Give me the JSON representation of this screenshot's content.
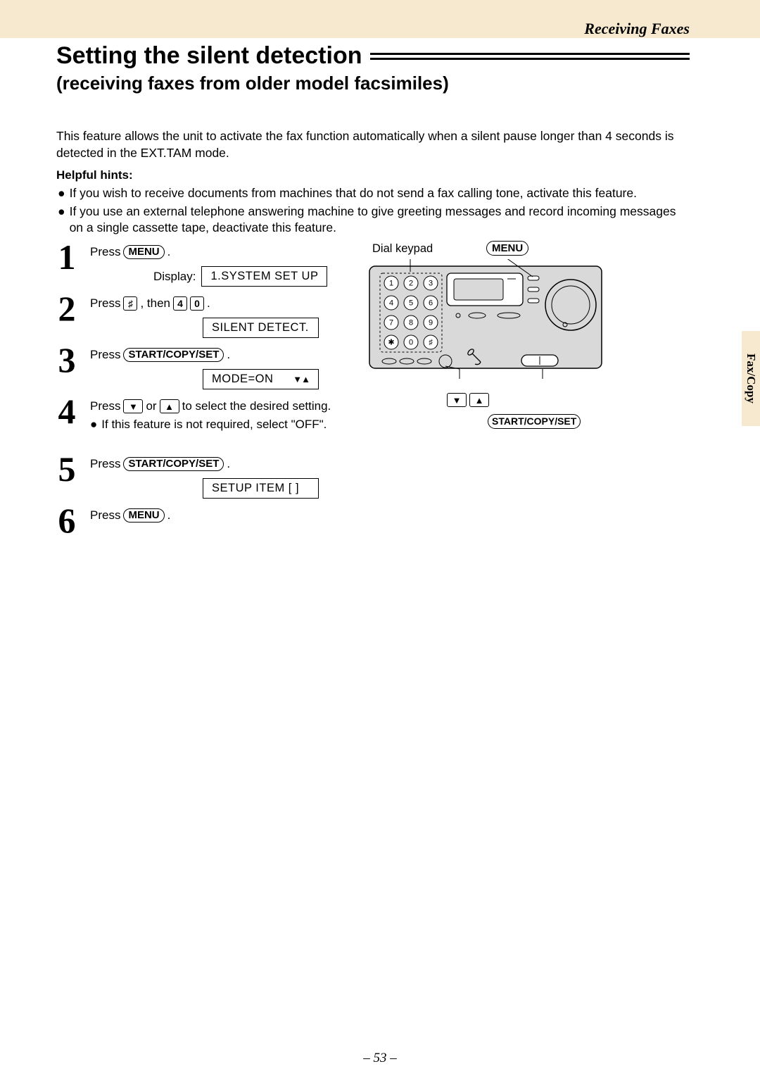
{
  "header": {
    "section": "Receiving Faxes",
    "title": "Setting the silent detection",
    "subtitle": "(receiving faxes from older model facsimiles)"
  },
  "intro": "This feature allows the unit to activate the fax function automatically when a silent pause longer than 4 seconds is detected in the EXT.TAM mode.",
  "hints": {
    "heading": "Helpful hints:",
    "items": [
      "If you wish to receive documents from machines that do not send a fax calling tone, activate this feature.",
      "If you use an external telephone answering machine to give greeting messages and record incoming messages on a single cassette tape, deactivate this feature."
    ]
  },
  "buttons": {
    "menu": "MENU",
    "start_copy_set": "START/COPY/SET"
  },
  "keys": {
    "hash": "♯",
    "four": "4",
    "zero": "0",
    "down": "▼",
    "up": "▲"
  },
  "diagram": {
    "dial_keypad_label": "Dial keypad",
    "menu_label": "MENU",
    "start_label": "START/COPY/SET",
    "arrows_down": "▼",
    "arrows_up": "▲",
    "keypad": [
      "1",
      "2",
      "3",
      "4",
      "5",
      "6",
      "7",
      "8",
      "9",
      "✱",
      "0",
      "♯"
    ]
  },
  "steps": [
    {
      "num": "1",
      "pre": "Press ",
      "btn": "MENU",
      "post": " .",
      "display_label": "Display:",
      "display_value": "1.SYSTEM SET UP"
    },
    {
      "num": "2",
      "pre": "Press ",
      "key1": "♯",
      "mid": " , then ",
      "key2": "4",
      "key3": "0",
      "post": " .",
      "display_value": "SILENT DETECT."
    },
    {
      "num": "3",
      "pre": "Press ",
      "btn": "START/COPY/SET",
      "post": " .",
      "display_value": "MODE=ON",
      "display_arrows": "▼▲"
    },
    {
      "num": "4",
      "pre": "Press ",
      "key_down": "▼",
      "mid": " or ",
      "key_up": "▲",
      "post": " to select the desired setting.",
      "bullet": "If this feature is not required, select \"OFF\"."
    },
    {
      "num": "5",
      "pre": "Press ",
      "btn": "START/COPY/SET",
      "post": " .",
      "display_value": "SETUP ITEM  [    ]"
    },
    {
      "num": "6",
      "pre": "Press ",
      "btn": "MENU",
      "post": " ."
    }
  ],
  "side_tab": "Fax/Copy",
  "page_number": "– 53 –"
}
